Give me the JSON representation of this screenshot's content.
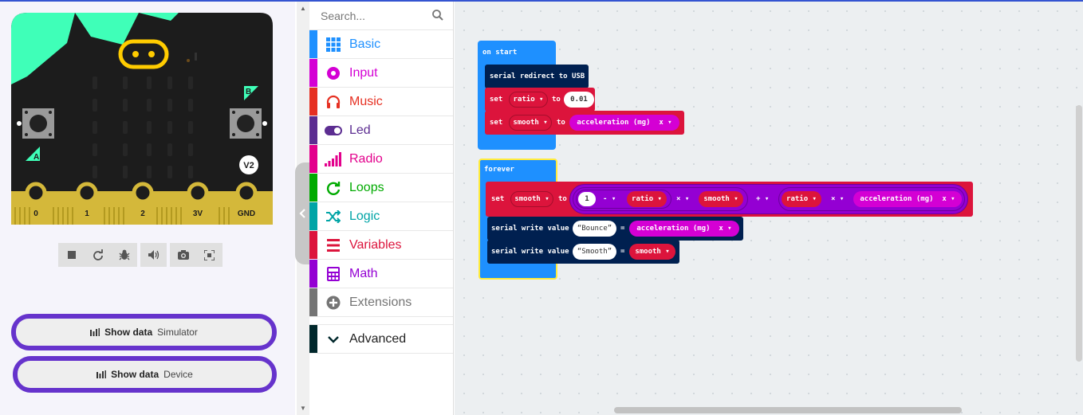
{
  "simulator": {
    "pins": [
      "0",
      "1",
      "2",
      "3V",
      "GND"
    ],
    "button_a": "A",
    "button_b": "B",
    "version_badge": "V2",
    "show_data_simulator": {
      "label": "Show data",
      "sub": "Simulator"
    },
    "show_data_device": {
      "label": "Show data",
      "sub": "Device"
    }
  },
  "toolbox": {
    "search_placeholder": "Search...",
    "categories": [
      {
        "label": "Basic",
        "color": "#1e90ff"
      },
      {
        "label": "Input",
        "color": "#d400d4"
      },
      {
        "label": "Music",
        "color": "#e63022"
      },
      {
        "label": "Led",
        "color": "#5c2d91"
      },
      {
        "label": "Radio",
        "color": "#e3008c"
      },
      {
        "label": "Loops",
        "color": "#00aa00"
      },
      {
        "label": "Logic",
        "color": "#00a4a6"
      },
      {
        "label": "Variables",
        "color": "#dc143c"
      },
      {
        "label": "Math",
        "color": "#9400d3"
      },
      {
        "label": "Extensions",
        "color": "#757575"
      }
    ],
    "advanced": {
      "label": "Advanced",
      "color": "#00272b"
    }
  },
  "workspace": {
    "on_start": {
      "hat": "on start",
      "redirect": "serial redirect to USB",
      "set1": {
        "kw": "set",
        "var": "ratio",
        "to": "to",
        "value": "0.01"
      },
      "set2": {
        "kw": "set",
        "var": "smooth",
        "to": "to",
        "input": "acceleration (mg)",
        "axis": "x"
      }
    },
    "forever": {
      "hat": "forever",
      "set": {
        "kw": "set",
        "var": "smooth",
        "to": "to",
        "one": "1",
        "minus": "-",
        "ratio": "ratio",
        "times": "×",
        "smooth": "smooth",
        "plus": "+",
        "ratio2": "ratio",
        "times2": "×",
        "input": "acceleration (mg)",
        "axis": "x"
      },
      "write1": {
        "kw": "serial write value",
        "name": "Bounce",
        "eq": "=",
        "input": "acceleration (mg)",
        "axis": "x"
      },
      "write2": {
        "kw": "serial write value",
        "name": "Smooth",
        "eq": "=",
        "var": "smooth"
      }
    }
  },
  "colors": {
    "accent": "#3454d1",
    "show_data_border": "#6633cc",
    "event_block": "#1e90ff",
    "serial_block": "#002050",
    "variable_block": "#dc143c",
    "math_block": "#9400d3",
    "input_block": "#d400d4"
  }
}
